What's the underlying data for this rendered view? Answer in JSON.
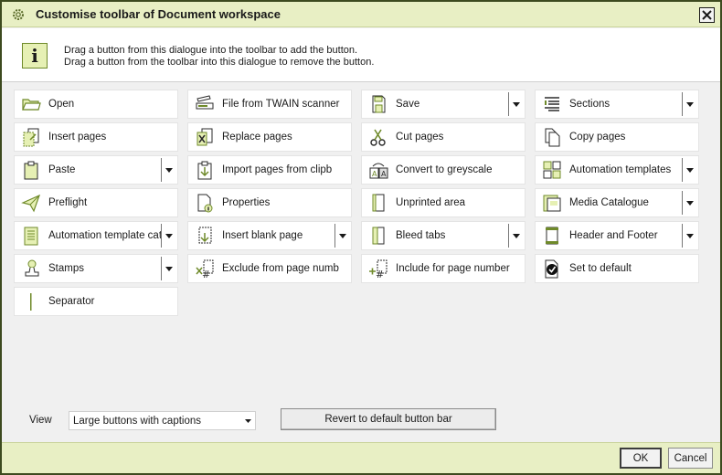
{
  "dialog": {
    "title": "Customise toolbar of Document workspace",
    "info_line1": "Drag a button from this dialogue into the toolbar to add the button.",
    "info_line2": "Drag a button from the toolbar into this dialogue to remove the button."
  },
  "buttons": [
    {
      "label": "Open",
      "icon": "open-folder-icon",
      "dropdown": false
    },
    {
      "label": "File from TWAIN scanner",
      "icon": "scanner-icon",
      "dropdown": false
    },
    {
      "label": "Save",
      "icon": "save-icon",
      "dropdown": true
    },
    {
      "label": "Sections",
      "icon": "sections-icon",
      "dropdown": true
    },
    {
      "label": "Insert pages",
      "icon": "insert-pages-icon",
      "dropdown": false
    },
    {
      "label": "Replace pages",
      "icon": "replace-pages-icon",
      "dropdown": false
    },
    {
      "label": "Cut pages",
      "icon": "scissors-icon",
      "dropdown": false
    },
    {
      "label": "Copy pages",
      "icon": "copy-pages-icon",
      "dropdown": false
    },
    {
      "label": "Paste",
      "icon": "clipboard-icon",
      "dropdown": true
    },
    {
      "label": "Import pages from clipb",
      "icon": "import-clipboard-icon",
      "dropdown": false
    },
    {
      "label": "Convert to greyscale",
      "icon": "greyscale-icon",
      "dropdown": false
    },
    {
      "label": "Automation templates",
      "icon": "automation-icon",
      "dropdown": true
    },
    {
      "label": "Preflight",
      "icon": "paper-plane-icon",
      "dropdown": false
    },
    {
      "label": "Properties",
      "icon": "properties-icon",
      "dropdown": false
    },
    {
      "label": "Unprinted area",
      "icon": "unprinted-area-icon",
      "dropdown": false
    },
    {
      "label": "Media Catalogue",
      "icon": "media-catalogue-icon",
      "dropdown": true
    },
    {
      "label": "Automation template cat",
      "icon": "template-catalogue-icon",
      "dropdown": true
    },
    {
      "label": "Insert blank page",
      "icon": "blank-page-icon",
      "dropdown": true
    },
    {
      "label": "Bleed tabs",
      "icon": "bleed-tabs-icon",
      "dropdown": true
    },
    {
      "label": "Header and Footer",
      "icon": "header-footer-icon",
      "dropdown": true
    },
    {
      "label": "Stamps",
      "icon": "stamp-icon",
      "dropdown": true
    },
    {
      "label": "Exclude from page numb",
      "icon": "exclude-numbering-icon",
      "dropdown": false
    },
    {
      "label": "Include for page number",
      "icon": "include-numbering-icon",
      "dropdown": false
    },
    {
      "label": "Set to default",
      "icon": "set-default-icon",
      "dropdown": false
    },
    {
      "label": "Separator",
      "icon": "separator-icon",
      "dropdown": false
    }
  ],
  "view": {
    "label": "View",
    "selected": "Large buttons with captions"
  },
  "revert_label": "Revert to default button bar",
  "footer": {
    "ok_label": "OK",
    "cancel_label": "Cancel"
  },
  "colors": {
    "accent": "#e8efc4",
    "icon_green": "#6f8a2a",
    "border_dark": "#3d4a1f"
  }
}
